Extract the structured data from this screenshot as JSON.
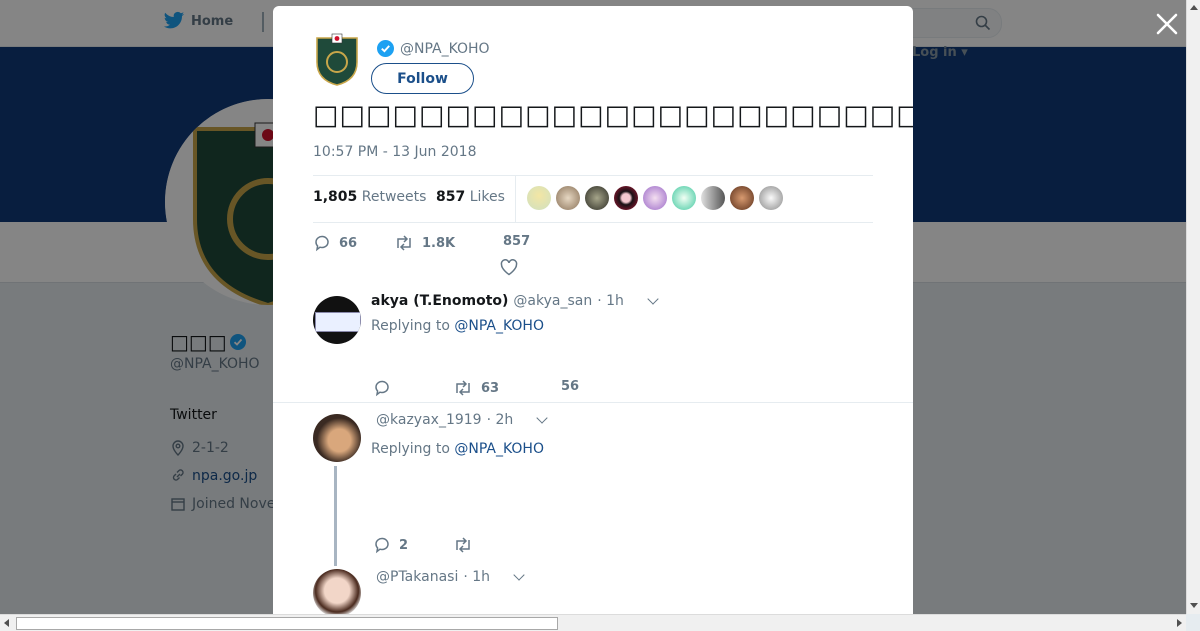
{
  "nav": {
    "home_label": "Home",
    "login_label": "Log in"
  },
  "profile": {
    "name": "□□□",
    "handle": "@NPA_KOHO",
    "bio": "Twitter",
    "location": "2-1-2",
    "website": "npa.go.jp",
    "joined": "Joined Nove"
  },
  "tweet": {
    "handle": "@NPA_KOHO",
    "follow_label": "Follow",
    "text": "□□□□□□□□□□□□□□□□□□□□□□□□□□□□□□□□□□□□□□□□□□□□□□□□□□□□□□□□",
    "timestamp": "10:57 PM - 13 Jun 2018",
    "retweets_count": "1,805",
    "retweets_label": "Retweets",
    "likes_count": "857",
    "likes_label": "Likes",
    "replies": "66",
    "retweets_short": "1.8K",
    "likes_short": "857"
  },
  "replies": [
    {
      "fullname": "akya (T.Enomoto)",
      "handle": "@akya_san",
      "time": "· 1h",
      "replying_prefix": "Replying to",
      "replying_to": "@NPA_KOHO",
      "replies": "",
      "retweets": "63",
      "likes": "56"
    },
    {
      "fullname": "",
      "handle": "@kazyax_1919",
      "time": "· 2h",
      "replying_prefix": "Replying to",
      "replying_to": "@NPA_KOHO",
      "replies": "2",
      "retweets": "",
      "likes": ""
    },
    {
      "fullname": "",
      "handle": "@PTakanasi",
      "time": "· 1h"
    }
  ],
  "colors": {
    "brand_blue": "#1b4f8a",
    "banner": "#113b7a",
    "verified": "#1da1f2"
  }
}
